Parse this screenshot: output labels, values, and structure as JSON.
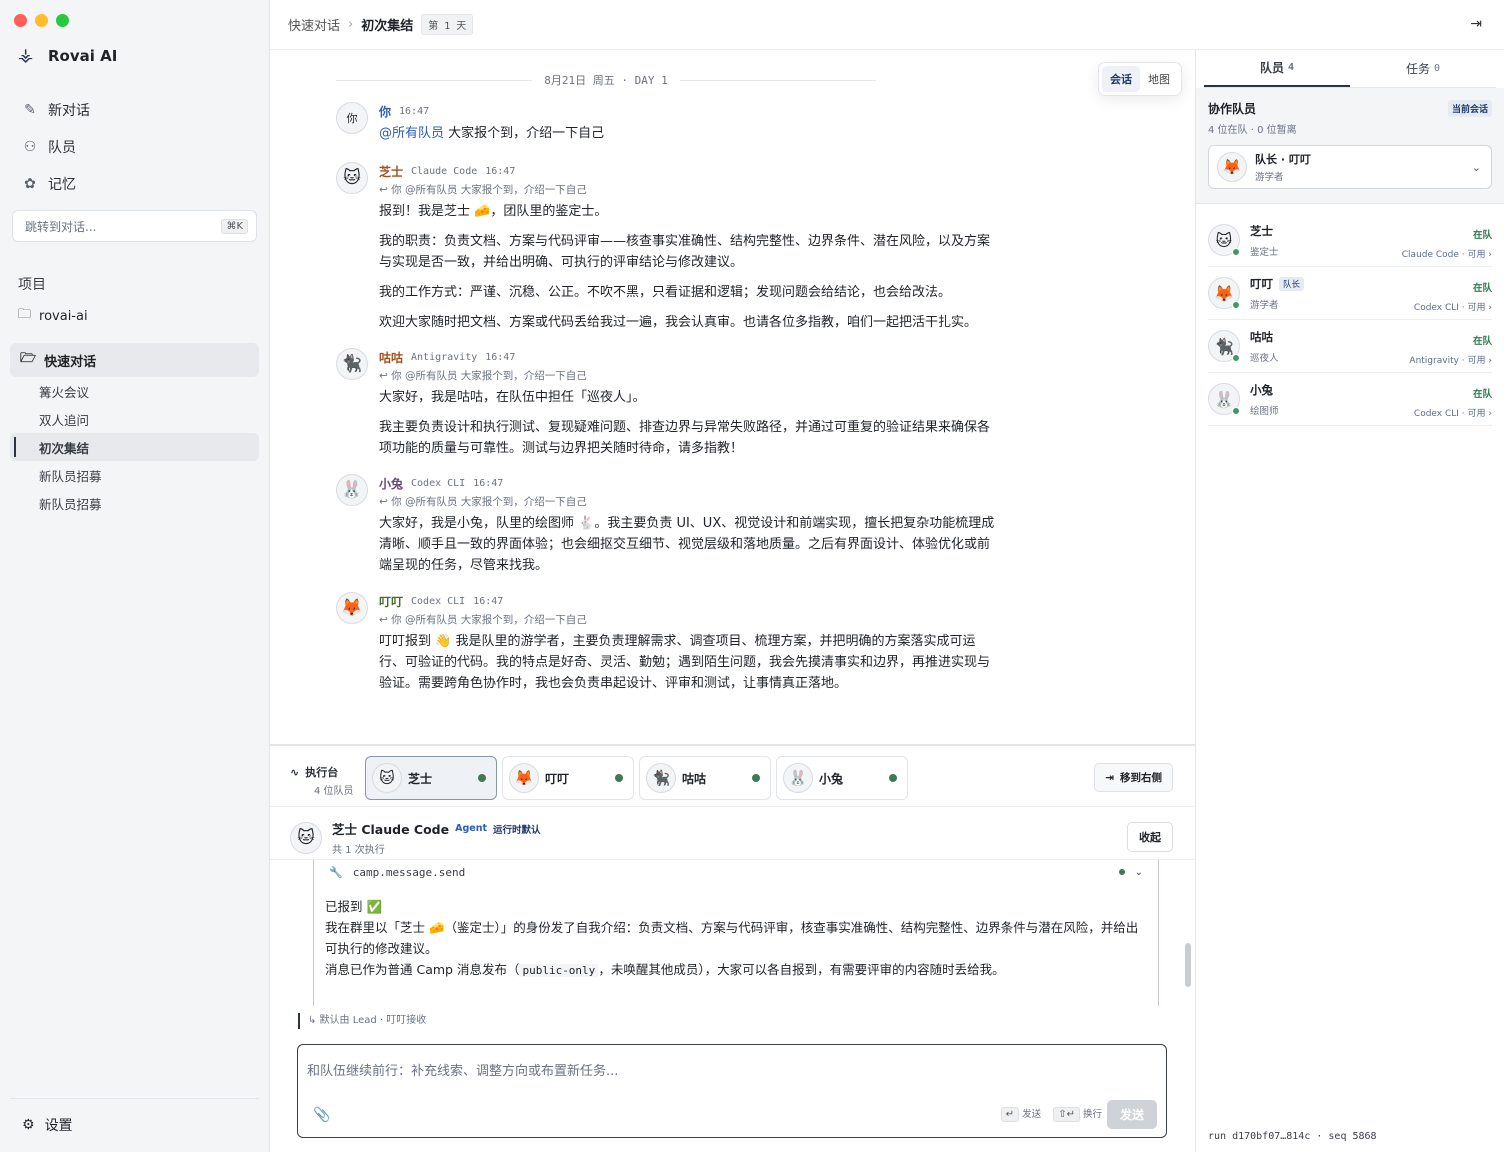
{
  "app": {
    "name": "Rovai AI"
  },
  "nav": [
    {
      "label": "新对话",
      "icon": "edit-icon"
    },
    {
      "label": "队员",
      "icon": "users-icon"
    },
    {
      "label": "记忆",
      "icon": "brain-icon"
    }
  ],
  "jump": {
    "placeholder": "跳转到对话...",
    "shortcut": "⌘K"
  },
  "projects": {
    "title": "项目",
    "items": [
      "rovai-ai"
    ]
  },
  "group": {
    "label": "快速对话",
    "items": [
      "篝火会议",
      "双人追问",
      "初次集结",
      "新队员招募",
      "新队员招募"
    ],
    "active_index": 2
  },
  "settings_label": "设置",
  "breadcrumb": {
    "parent": "快速对话",
    "current": "初次集结",
    "badge": "第 1 天"
  },
  "chat": {
    "day_separator": "8月21日 周五 · DAY 1",
    "view_toggle": [
      "会话",
      "地图"
    ],
    "messages": [
      {
        "name": "你",
        "client": "",
        "time": "16:47",
        "name_color": "#2a5bbf",
        "avatar": "你",
        "reply": "",
        "mention": "@所有队员",
        "paras": [
          "大家报个到，介绍一下自己"
        ]
      },
      {
        "name": "芝士",
        "client": "Claude Code",
        "time": "16:47",
        "name_color": "#a0521e",
        "avatar": "🐱",
        "reply": "↩ 你 @所有队员 大家报个到，介绍一下自己",
        "mention": "",
        "paras": [
          "报到！我是芝士 🧀，团队里的鉴定士。",
          "我的职责：负责文档、方案与代码评审——核查事实准确性、结构完整性、边界条件、潜在风险，以及方案与实现是否一致，并给出明确、可执行的评审结论与修改建议。",
          "我的工作方式：严谨、沉稳、公正。不吹不黑，只看证据和逻辑；发现问题会给结论，也会给改法。",
          "欢迎大家随时把文档、方案或代码丢给我过一遍，我会认真审。也请各位多指教，咱们一起把活干扎实。"
        ]
      },
      {
        "name": "咕咕",
        "client": "Antigravity",
        "time": "16:47",
        "name_color": "#a0521e",
        "avatar": "🐈‍⬛",
        "reply": "↩ 你 @所有队员 大家报个到，介绍一下自己",
        "mention": "",
        "paras": [
          "大家好，我是咕咕，在队伍中担任「巡夜人」。",
          "我主要负责设计和执行测试、复现疑难问题、排查边界与异常失败路径，并通过可重复的验证结果来确保各项功能的质量与可靠性。测试与边界把关随时待命，请多指教！"
        ]
      },
      {
        "name": "小兔",
        "client": "Codex CLI",
        "time": "16:47",
        "name_color": "#6b4a7a",
        "avatar": "🐰",
        "reply": "↩ 你 @所有队员 大家报个到，介绍一下自己",
        "mention": "",
        "paras": [
          "大家好，我是小兔，队里的绘图师 🐇。我主要负责 UI、UX、视觉设计和前端实现，擅长把复杂功能梳理成清晰、顺手且一致的界面体验；也会细抠交互细节、视觉层级和落地质量。之后有界面设计、体验优化或前端呈现的任务，尽管来找我。"
        ]
      },
      {
        "name": "叮叮",
        "client": "Codex CLI",
        "time": "16:47",
        "name_color": "#4a6b2e",
        "avatar": "🦊",
        "reply": "↩ 你 @所有队员 大家报个到，介绍一下自己",
        "mention": "",
        "paras": [
          "叮叮报到 👋 我是队里的游学者，主要负责理解需求、调查项目、梳理方案，并把明确的方案落实成可运行、可验证的代码。我的特点是好奇、灵活、勤勉；遇到陌生问题，我会先摸清事实和边界，再推进实现与验证。需要跨角色协作时，我也会负责串起设计、评审和测试，让事情真正落地。"
        ]
      }
    ]
  },
  "workbench": {
    "title": "执行台",
    "subtitle": "4 位队员",
    "agents": [
      {
        "name": "芝士",
        "avatar": "🐱"
      },
      {
        "name": "叮叮",
        "avatar": "🦊"
      },
      {
        "name": "咕咕",
        "avatar": "🐈‍⬛"
      },
      {
        "name": "小兔",
        "avatar": "🐰"
      }
    ],
    "move_label": "移到右侧"
  },
  "agent_panel": {
    "title": "芝士 Claude Code",
    "tag": "Agent",
    "tag2": "运行时默认",
    "runs": "共 1 次执行",
    "fold_label": "收起",
    "tool_name": "camp.message.send",
    "output_lines": [
      "已报到 ✅",
      "我在群里以「芝士 🧀（鉴定士）」的身份发了自我介绍：负责文档、方案与代码评审，核查事实准确性、结构完整性、边界条件与潜在风险，并给出可执行的修改建议。",
      "消息已作为普通 Camp 消息发布（",
      "public-only",
      "，未唤醒其他成员），大家可以各自报到，有需要评审的内容随时丢给我。"
    ]
  },
  "routing_note": "↳ 默认由 Lead · 叮叮接收",
  "composer": {
    "placeholder": "和队伍继续前行：补充线索、调整方向或布置新任务...",
    "hint_send": "发送",
    "hint_newline": "换行",
    "send_label": "发送",
    "key_enter": "↵",
    "key_shift": "⇧↵"
  },
  "right_panel": {
    "tabs": [
      {
        "label": "队员",
        "count": "4"
      },
      {
        "label": "任务",
        "count": "0"
      }
    ],
    "team_title": "协作队员",
    "team_badge": "当前会话",
    "team_sub": "4 位在队 · 0 位暂离",
    "leader": {
      "title": "队长 · 叮叮",
      "role": "游学者",
      "avatar": "🦊"
    },
    "members": [
      {
        "name": "芝士",
        "role": "鉴定士",
        "status": "在队",
        "runtime": "Claude Code · 可用",
        "lead": "",
        "avatar": "🐱"
      },
      {
        "name": "叮叮",
        "role": "游学者",
        "status": "在队",
        "runtime": "Codex CLI · 可用",
        "lead": "队长",
        "avatar": "🦊"
      },
      {
        "name": "咕咕",
        "role": "巡夜人",
        "status": "在队",
        "runtime": "Antigravity · 可用",
        "lead": "",
        "avatar": "🐈‍⬛"
      },
      {
        "name": "小兔",
        "role": "绘图师",
        "status": "在队",
        "runtime": "Codex CLI · 可用",
        "lead": "",
        "avatar": "🐰"
      }
    ],
    "run_info": "run d170bf07…814c · seq 5868"
  },
  "colors": {
    "accent": "#2a5bbf",
    "online": "#3f7a55"
  }
}
